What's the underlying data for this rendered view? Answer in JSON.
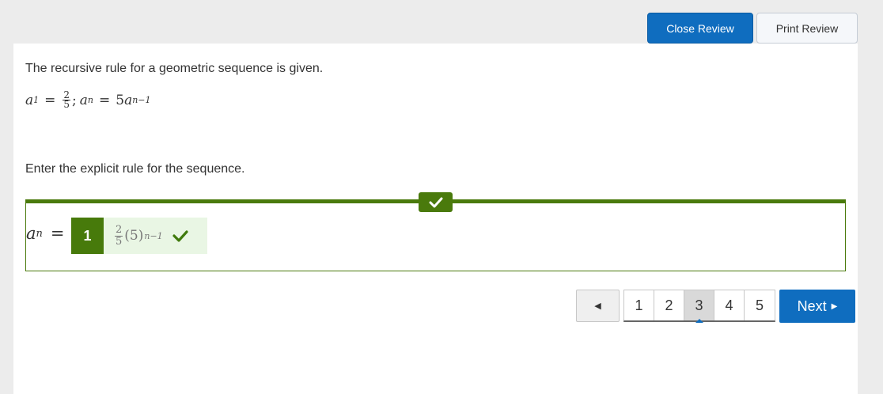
{
  "header": {
    "close_label": "Close Review",
    "print_label": "Print Review"
  },
  "question": {
    "prompt": "The recursive rule for a geometric sequence is given.",
    "rule": {
      "a1_symbol": "a",
      "a1_sub": "1",
      "eq1": "=",
      "frac_num": "2",
      "frac_den": "5",
      "sep": ";",
      "an_symbol": "a",
      "an_sub": "n",
      "eq2": "=",
      "coef": "5",
      "prev_symbol": "a",
      "prev_sub": "n−1"
    },
    "instruction": "Enter the explicit rule for the sequence."
  },
  "answer": {
    "lhs_symbol": "a",
    "lhs_sub": "n",
    "lhs_eq": "=",
    "response_number": "1",
    "frac_num": "2",
    "frac_den": "5",
    "base": "(5)",
    "exponent": "n−1",
    "status": "correct",
    "status_color": "#4a7a0c"
  },
  "pagination": {
    "prev_label": "◀",
    "pages": [
      "1",
      "2",
      "3",
      "4",
      "5"
    ],
    "current": "3",
    "next_label": "Next",
    "next_arrow": "▶"
  }
}
